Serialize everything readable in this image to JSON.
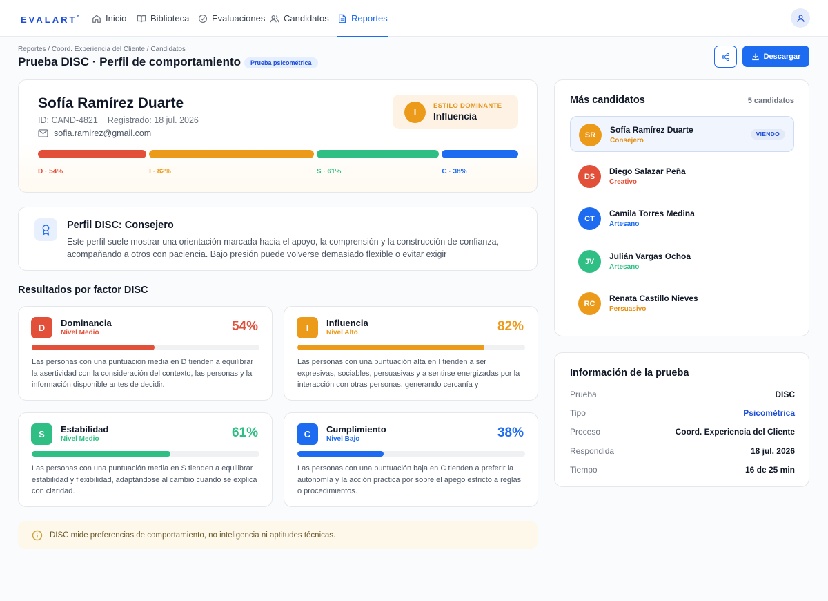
{
  "nav": {
    "logo": "EVALART",
    "logo_mark": "°",
    "items": [
      {
        "label": "Inicio",
        "icon": "home-icon"
      },
      {
        "label": "Biblioteca",
        "icon": "book-icon"
      },
      {
        "label": "Evaluaciones",
        "icon": "check-circle-icon"
      },
      {
        "label": "Candidatos",
        "icon": "users-icon"
      },
      {
        "label": "Reportes",
        "icon": "document-icon",
        "active": true
      }
    ]
  },
  "header": {
    "breadcrumb": "Reportes / Coord. Experiencia del Cliente / Candidatos",
    "title": "Prueba DISC · Perfil de comportamiento",
    "badge": "Prueba psicométrica",
    "download_label": "Descargar"
  },
  "candidate": {
    "name": "Sofía Ramírez Duarte",
    "id": "ID: CAND-4821",
    "registered": "Registrado: 18 jul. 2026",
    "email": "sofia.ramirez@gmail.com",
    "dominant_label": "ESTILO DOMINANTE",
    "dominant_letter": "I",
    "dominant_value": "Influencia",
    "scores": [
      {
        "label": "D · 54%",
        "value": 54,
        "color": "#e2503a"
      },
      {
        "label": "I · 82%",
        "value": 82,
        "color": "#ec9a1a"
      },
      {
        "label": "S · 61%",
        "value": 61,
        "color": "#2fbf84"
      },
      {
        "label": "C · 38%",
        "value": 38,
        "color": "#1d6bf0"
      }
    ]
  },
  "profile": {
    "title": "Perfil DISC: Consejero",
    "description": "Este perfil suele mostrar una orientación marcada hacia el apoyo, la comprensión y la construcción de confianza, acompañando a otros con paciencia. Bajo presión puede volverse demasiado flexible o evitar exigir"
  },
  "factors_title": "Resultados por factor DISC",
  "factors": [
    {
      "letter": "D",
      "name": "Dominancia",
      "level": "Nivel Medio",
      "percent": "54%",
      "value": 54,
      "color": "#e2503a",
      "description": "Las personas con una puntuación media en D tienden a equilibrar la asertividad con la consideración del contexto, las personas y la información disponible antes de decidir."
    },
    {
      "letter": "I",
      "name": "Influencia",
      "level": "Nivel Alto",
      "percent": "82%",
      "value": 82,
      "color": "#ec9a1a",
      "description": "Las personas con una puntuación alta en I tienden a ser expresivas, sociables, persuasivas y a sentirse energizadas por la interacción con otras personas, generando cercanía y"
    },
    {
      "letter": "S",
      "name": "Estabilidad",
      "level": "Nivel Medio",
      "percent": "61%",
      "value": 61,
      "color": "#2fbf84",
      "description": "Las personas con una puntuación media en S tienden a equilibrar estabilidad y flexibilidad, adaptándose al cambio cuando se explica con claridad."
    },
    {
      "letter": "C",
      "name": "Cumplimiento",
      "level": "Nivel Bajo",
      "percent": "38%",
      "value": 38,
      "color": "#1d6bf0",
      "description": "Las personas con una puntuación baja en C tienden a preferir la autonomía y la acción práctica por sobre el apego estricto a reglas o procedimientos."
    }
  ],
  "note": "DISC mide preferencias de comportamiento, no inteligencia ni aptitudes técnicas.",
  "more_candidates": {
    "title": "Más candidatos",
    "count": "5 candidatos",
    "viewing_label": "VIENDO",
    "items": [
      {
        "initials": "SR",
        "name": "Sofía Ramírez Duarte",
        "role": "Consejero",
        "avatar_color": "#ec9a1a",
        "role_color": "#e58f12",
        "current": true
      },
      {
        "initials": "DS",
        "name": "Diego Salazar Peña",
        "role": "Creativo",
        "avatar_color": "#e2503a",
        "role_color": "#e2503a",
        "current": false
      },
      {
        "initials": "CT",
        "name": "Camila Torres Medina",
        "role": "Artesano",
        "avatar_color": "#1d6bf0",
        "role_color": "#1d6bf0",
        "current": false
      },
      {
        "initials": "JV",
        "name": "Julián Vargas Ochoa",
        "role": "Artesano",
        "avatar_color": "#2fbf84",
        "role_color": "#2fbf84",
        "current": false
      },
      {
        "initials": "RC",
        "name": "Renata Castillo Nieves",
        "role": "Persuasivo",
        "avatar_color": "#ec9a1a",
        "role_color": "#e58f12",
        "current": false
      }
    ]
  },
  "test_info": {
    "title": "Información de la prueba",
    "rows": [
      {
        "key": "Prueba",
        "value": "DISC"
      },
      {
        "key": "Tipo",
        "value": "Psicométrica",
        "accent": "#1d4ed8"
      },
      {
        "key": "Proceso",
        "value": "Coord. Experiencia del Cliente"
      },
      {
        "key": "Respondida",
        "value": "18 jul. 2026"
      },
      {
        "key": "Tiempo",
        "value": "16 de 25 min"
      }
    ]
  }
}
